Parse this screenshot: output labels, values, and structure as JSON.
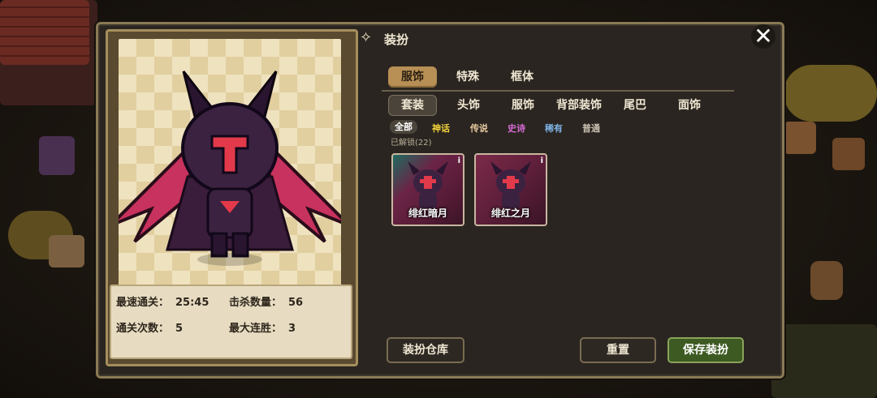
{
  "header": {
    "title": "装扮"
  },
  "main_tabs": [
    {
      "label": "服饰",
      "active": true
    },
    {
      "label": "特殊",
      "active": false
    },
    {
      "label": "框体",
      "active": false
    }
  ],
  "sub_tabs": [
    {
      "label": "套装",
      "active": true
    },
    {
      "label": "头饰",
      "active": false
    },
    {
      "label": "服饰",
      "active": false
    },
    {
      "label": "背部装饰",
      "active": false
    },
    {
      "label": "尾巴",
      "active": false
    },
    {
      "label": "面饰",
      "active": false
    }
  ],
  "rarity_filters": [
    {
      "label": "全部",
      "color": "#ffffff",
      "active": true
    },
    {
      "label": "神话",
      "color": "#f2d23a",
      "active": false
    },
    {
      "label": "传说",
      "color": "#e6c9a0",
      "active": false
    },
    {
      "label": "史诗",
      "color": "#d36ad0",
      "active": false
    },
    {
      "label": "稀有",
      "color": "#7fb4e6",
      "active": false
    },
    {
      "label": "普通",
      "color": "#c9c2b2",
      "active": false
    }
  ],
  "unlocked_label": "已解锁(22)",
  "items": [
    {
      "name": "绯红暗月",
      "info_icon": "i"
    },
    {
      "name": "绯红之月",
      "info_icon": "i"
    }
  ],
  "stats": {
    "fastest_clear_label": "最速通关：",
    "fastest_clear_value": "25:45",
    "kills_label": "击杀数量：",
    "kills_value": "56",
    "clears_label": "通关次数：",
    "clears_value": "5",
    "max_streak_label": "最大连胜：",
    "max_streak_value": "3"
  },
  "buttons": {
    "wardrobe": "装扮仓库",
    "reset": "重置",
    "save": "保存装扮"
  },
  "icons": {
    "close": "close-icon",
    "title": "sparkle-icon",
    "info": "info-icon"
  },
  "colors": {
    "accent_tab": "#b88f55",
    "save_button": "#3d5a22",
    "item_bg": "#6b2446"
  }
}
